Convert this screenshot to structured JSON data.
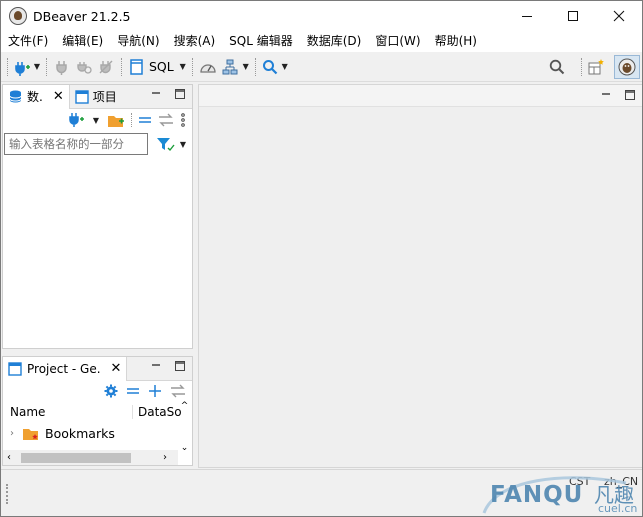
{
  "window": {
    "title": "DBeaver 21.2.5"
  },
  "menu": [
    "文件(F)",
    "编辑(E)",
    "导航(N)",
    "搜索(A)",
    "SQL 编辑器",
    "数据库(D)",
    "窗口(W)",
    "帮助(H)"
  ],
  "toolbar": {
    "sql_label": "SQL"
  },
  "nav_panel": {
    "tabs": [
      {
        "label": "数."
      },
      {
        "label": "项目"
      }
    ],
    "filter_placeholder": "输入表格名称的一部分"
  },
  "project_panel": {
    "tab_label": "Project - Ge.",
    "columns": [
      "Name",
      "DataSo"
    ],
    "items": [
      {
        "label": "Bookmarks"
      }
    ]
  },
  "status": {
    "timezone": "CST",
    "locale": "zh_CN"
  },
  "watermark": {
    "brand": "FANQU",
    "brand_cn": "凡趣",
    "domain": "cuel.cn"
  },
  "colors": {
    "accent_blue": "#1f7fd6",
    "folder_orange": "#f0a030",
    "filter_blue": "#1a8ad4"
  }
}
